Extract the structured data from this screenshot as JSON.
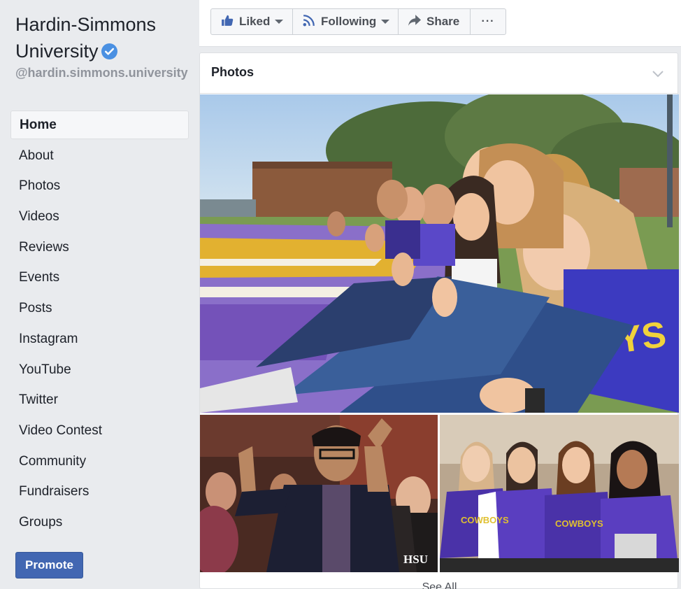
{
  "page": {
    "name": "Hardin-Simmons University",
    "username": "@hardin.simmons.university",
    "verified_icon": "verified-badge-icon"
  },
  "sidebar": {
    "items": [
      {
        "label": "Home",
        "active": true
      },
      {
        "label": "About"
      },
      {
        "label": "Photos"
      },
      {
        "label": "Videos"
      },
      {
        "label": "Reviews"
      },
      {
        "label": "Events"
      },
      {
        "label": "Posts"
      },
      {
        "label": "Instagram"
      },
      {
        "label": "YouTube"
      },
      {
        "label": "Twitter"
      },
      {
        "label": "Video Contest"
      },
      {
        "label": "Community"
      },
      {
        "label": "Fundraisers"
      },
      {
        "label": "Groups"
      }
    ],
    "promote_label": "Promote"
  },
  "actions": {
    "liked_label": "Liked",
    "following_label": "Following",
    "share_label": "Share",
    "more_label": "···"
  },
  "photos": {
    "title": "Photos",
    "see_all_label": "See All",
    "watermark": "HSU"
  },
  "colors": {
    "brand_blue": "#4267b2",
    "background": "#e9ebee",
    "verified": "#4a90e2"
  }
}
